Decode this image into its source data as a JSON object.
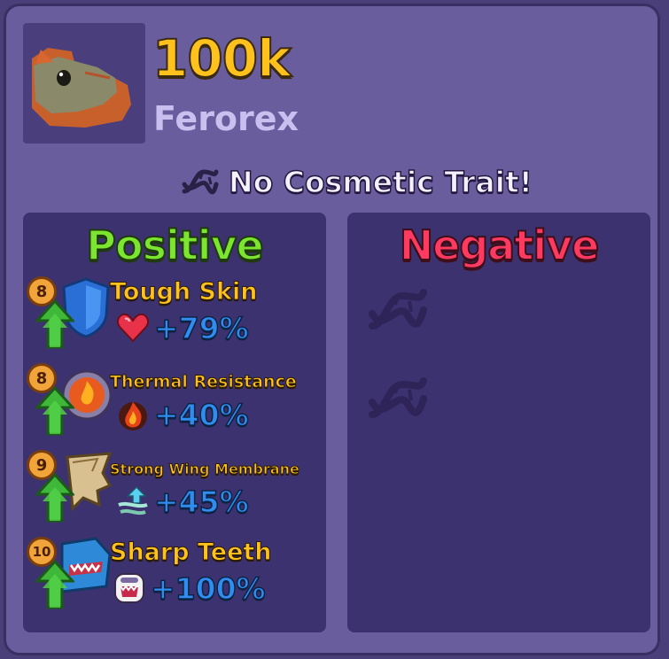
{
  "creature": {
    "value": "100k",
    "species": "Ferorex"
  },
  "cosmetic": {
    "text": "No Cosmetic Trait!",
    "icon": "dna-icon"
  },
  "positive": {
    "title": "Positive",
    "traits": [
      {
        "level": "8",
        "name": "Tough Skin",
        "value": "+79%",
        "icon": "shield-icon",
        "stat_icon": "heart-icon"
      },
      {
        "level": "8",
        "name": "Thermal Resistance",
        "value": "+40%",
        "icon": "fire-shield-icon",
        "stat_icon": "flame-icon"
      },
      {
        "level": "9",
        "name": "Strong Wing Membrane",
        "value": "+45%",
        "icon": "wing-icon",
        "stat_icon": "wind-arrow-icon"
      },
      {
        "level": "10",
        "name": "Sharp Teeth",
        "value": "+100%",
        "icon": "shark-jaw-icon",
        "stat_icon": "bite-icon"
      }
    ]
  },
  "negative": {
    "title": "Negative",
    "slots": [
      "dna-icon",
      "dna-icon"
    ]
  },
  "colors": {
    "value_gold": "#ffc21c",
    "positive_green": "#7be52f",
    "negative_red": "#ff3a60",
    "stat_blue": "#2f8df0",
    "panel_bg": "#3d3270",
    "frame_bg": "#6a5d9e"
  }
}
